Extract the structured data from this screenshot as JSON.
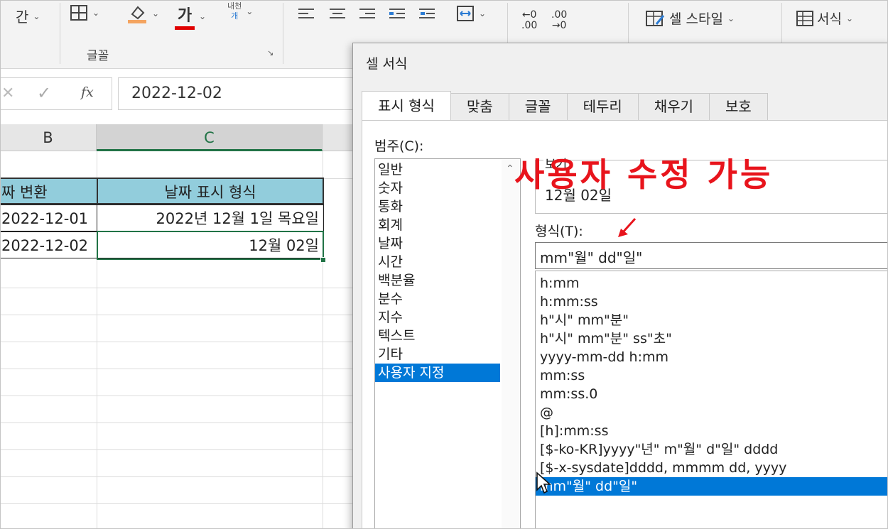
{
  "ribbon": {
    "font_size_frag": "간",
    "font_color_glyph": "가",
    "phonetic_top": "내천",
    "phonetic_bottom": "개",
    "increase_decimal_top": "←0",
    "increase_decimal_bottom": ".00",
    "decrease_decimal_top": ".00",
    "decrease_decimal_bottom": "→0",
    "cell_style": "셀 스타일",
    "format": "서식",
    "group_label": "글꼴",
    "fill_color": "#f4a460",
    "font_color": "#e00000"
  },
  "formula_bar": {
    "cancel_glyph": "✕",
    "confirm_glyph": "✓",
    "fx": "fx",
    "content": "2022-12-02"
  },
  "grid": {
    "columns": [
      "B",
      "C"
    ],
    "header_row": [
      "짜 변환",
      "날짜 표시 형식"
    ],
    "rows": [
      [
        "2022-12-01",
        "2022년 12월 1일 목요일"
      ],
      [
        "2022-12-02",
        "12월 02일"
      ]
    ]
  },
  "dialog": {
    "title": "셀 서식",
    "tabs": [
      "표시 형식",
      "맞춤",
      "글꼴",
      "테두리",
      "채우기",
      "보호"
    ],
    "category_label": "범주(C):",
    "categories": [
      "일반",
      "숫자",
      "통화",
      "회계",
      "날짜",
      "시간",
      "백분율",
      "분수",
      "지수",
      "텍스트",
      "기타",
      "사용자 지정"
    ],
    "sample_label": "보기",
    "sample_value": "12월 02일",
    "type_label": "형식(T):",
    "type_value": "mm\"월\" dd\"일\"",
    "type_list": [
      "h:mm",
      "h:mm:ss",
      "h\"시\" mm\"분\"",
      "h\"시\" mm\"분\" ss\"초\"",
      "yyyy-mm-dd h:mm",
      "mm:ss",
      "mm:ss.0",
      "@",
      "[h]:mm:ss",
      "[$-ko-KR]yyyy\"년\" m\"월\" d\"일\" dddd",
      "[$-x-sysdate]dddd, mmmm dd, yyyy",
      "mm\"월\" dd\"일\""
    ]
  },
  "annotation": "사용자 수정 가능",
  "colors": {
    "accent": "#217346",
    "selection": "#0078d7",
    "header_fill": "#92cddc",
    "annotation": "#e8141c"
  }
}
